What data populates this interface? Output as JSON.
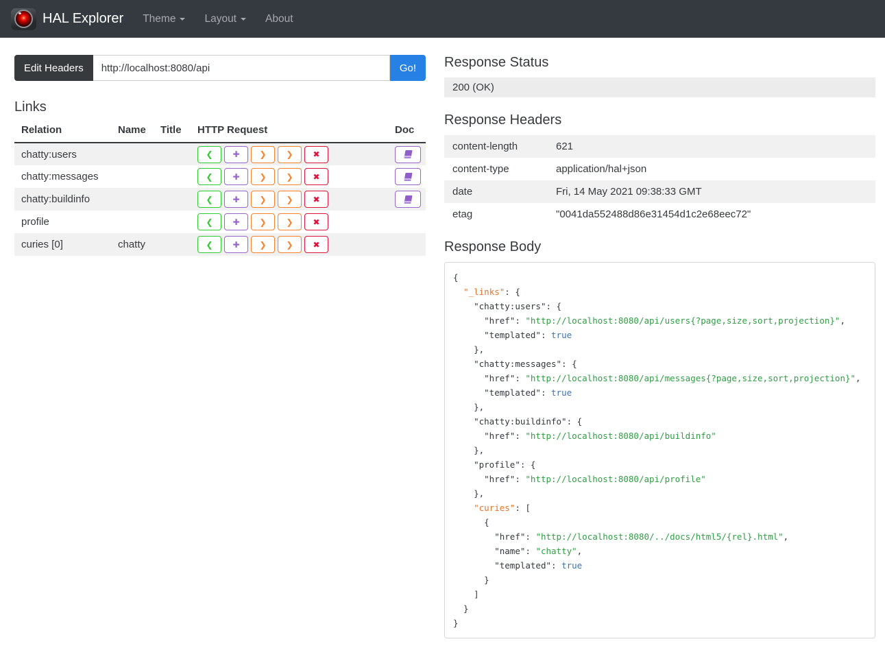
{
  "navbar": {
    "brand": "HAL Explorer",
    "items": [
      {
        "id": "theme",
        "label": "Theme",
        "caret": true
      },
      {
        "id": "layout",
        "label": "Layout",
        "caret": true
      },
      {
        "id": "about",
        "label": "About",
        "caret": false
      }
    ]
  },
  "request_bar": {
    "edit_headers_label": "Edit Headers",
    "url_value": "http://localhost:8080/api",
    "go_label": "Go!"
  },
  "links_section": {
    "title": "Links",
    "columns": [
      "Relation",
      "Name",
      "Title",
      "HTTP Request",
      "Doc"
    ],
    "http_buttons": [
      {
        "method": "get",
        "glyph": "❮"
      },
      {
        "method": "post",
        "glyph": "✚"
      },
      {
        "method": "put",
        "glyph": "❯"
      },
      {
        "method": "patch",
        "glyph": "❯"
      },
      {
        "method": "delete",
        "glyph": "✖"
      }
    ],
    "rows": [
      {
        "relation": "chatty:users",
        "name": "",
        "title": "",
        "doc": true
      },
      {
        "relation": "chatty:messages",
        "name": "",
        "title": "",
        "doc": true
      },
      {
        "relation": "chatty:buildinfo",
        "name": "",
        "title": "",
        "doc": true
      },
      {
        "relation": "profile",
        "name": "",
        "title": "",
        "doc": false
      },
      {
        "relation": "curies [0]",
        "name": "chatty",
        "title": "",
        "doc": false
      }
    ]
  },
  "response_status": {
    "title": "Response Status",
    "value": "200 (OK)"
  },
  "response_headers": {
    "title": "Response Headers",
    "rows": [
      {
        "name": "content-length",
        "value": "621"
      },
      {
        "name": "content-type",
        "value": "application/hal+json"
      },
      {
        "name": "date",
        "value": "Fri, 14 May 2021 09:38:33 GMT"
      },
      {
        "name": "etag",
        "value": "\"0041da552488d86e31454d1c2e68eec72\""
      }
    ]
  },
  "response_body": {
    "title": "Response Body",
    "lines": [
      [
        [
          "p",
          "{"
        ]
      ],
      [
        [
          "p",
          "  "
        ],
        [
          "keyx",
          "\"_links\""
        ],
        [
          "p",
          ": {"
        ]
      ],
      [
        [
          "p",
          "    "
        ],
        [
          "key",
          "\"chatty:users\""
        ],
        [
          "p",
          ": {"
        ]
      ],
      [
        [
          "p",
          "      "
        ],
        [
          "key",
          "\"href\""
        ],
        [
          "p",
          ": "
        ],
        [
          "str",
          "\"http://localhost:8080/api/users{?page,size,sort,projection}\""
        ],
        [
          "p",
          ","
        ]
      ],
      [
        [
          "p",
          "      "
        ],
        [
          "key",
          "\"templated\""
        ],
        [
          "p",
          ": "
        ],
        [
          "bool",
          "true"
        ]
      ],
      [
        [
          "p",
          "    },"
        ]
      ],
      [
        [
          "p",
          "    "
        ],
        [
          "key",
          "\"chatty:messages\""
        ],
        [
          "p",
          ": {"
        ]
      ],
      [
        [
          "p",
          "      "
        ],
        [
          "key",
          "\"href\""
        ],
        [
          "p",
          ": "
        ],
        [
          "str",
          "\"http://localhost:8080/api/messages{?page,size,sort,projection}\""
        ],
        [
          "p",
          ","
        ]
      ],
      [
        [
          "p",
          "      "
        ],
        [
          "key",
          "\"templated\""
        ],
        [
          "p",
          ": "
        ],
        [
          "bool",
          "true"
        ]
      ],
      [
        [
          "p",
          "    },"
        ]
      ],
      [
        [
          "p",
          "    "
        ],
        [
          "key",
          "\"chatty:buildinfo\""
        ],
        [
          "p",
          ": {"
        ]
      ],
      [
        [
          "p",
          "      "
        ],
        [
          "key",
          "\"href\""
        ],
        [
          "p",
          ": "
        ],
        [
          "str",
          "\"http://localhost:8080/api/buildinfo\""
        ]
      ],
      [
        [
          "p",
          "    },"
        ]
      ],
      [
        [
          "p",
          "    "
        ],
        [
          "key",
          "\"profile\""
        ],
        [
          "p",
          ": {"
        ]
      ],
      [
        [
          "p",
          "      "
        ],
        [
          "key",
          "\"href\""
        ],
        [
          "p",
          ": "
        ],
        [
          "str",
          "\"http://localhost:8080/api/profile\""
        ]
      ],
      [
        [
          "p",
          "    },"
        ]
      ],
      [
        [
          "p",
          "    "
        ],
        [
          "keyx",
          "\"curies\""
        ],
        [
          "p",
          ": ["
        ]
      ],
      [
        [
          "p",
          "      {"
        ]
      ],
      [
        [
          "p",
          "        "
        ],
        [
          "key",
          "\"href\""
        ],
        [
          "p",
          ": "
        ],
        [
          "str",
          "\"http://localhost:8080/../docs/html5/{rel}.html\""
        ],
        [
          "p",
          ","
        ]
      ],
      [
        [
          "p",
          "        "
        ],
        [
          "key",
          "\"name\""
        ],
        [
          "p",
          ": "
        ],
        [
          "str",
          "\"chatty\""
        ],
        [
          "p",
          ","
        ]
      ],
      [
        [
          "p",
          "        "
        ],
        [
          "key",
          "\"templated\""
        ],
        [
          "p",
          ": "
        ],
        [
          "bool",
          "true"
        ]
      ],
      [
        [
          "p",
          "      }"
        ]
      ],
      [
        [
          "p",
          "    ]"
        ]
      ],
      [
        [
          "p",
          "  }"
        ]
      ],
      [
        [
          "p",
          "}"
        ]
      ]
    ]
  },
  "colors": {
    "navbar_bg": "#343a40",
    "primary": "#2780e3",
    "dark": "#373a3c",
    "get_green": "#2fcc2f",
    "post_purple": "#9966cc",
    "put_patch_orange": "#f8832c",
    "delete_crimson": "#dc143c",
    "doc_purple": "#9966cc",
    "json_special_key": "#e8742f",
    "json_string": "#2f9e44",
    "json_boolean": "#3e72ac",
    "stripe": "#f1f1f1",
    "status_bg": "#ececec"
  }
}
